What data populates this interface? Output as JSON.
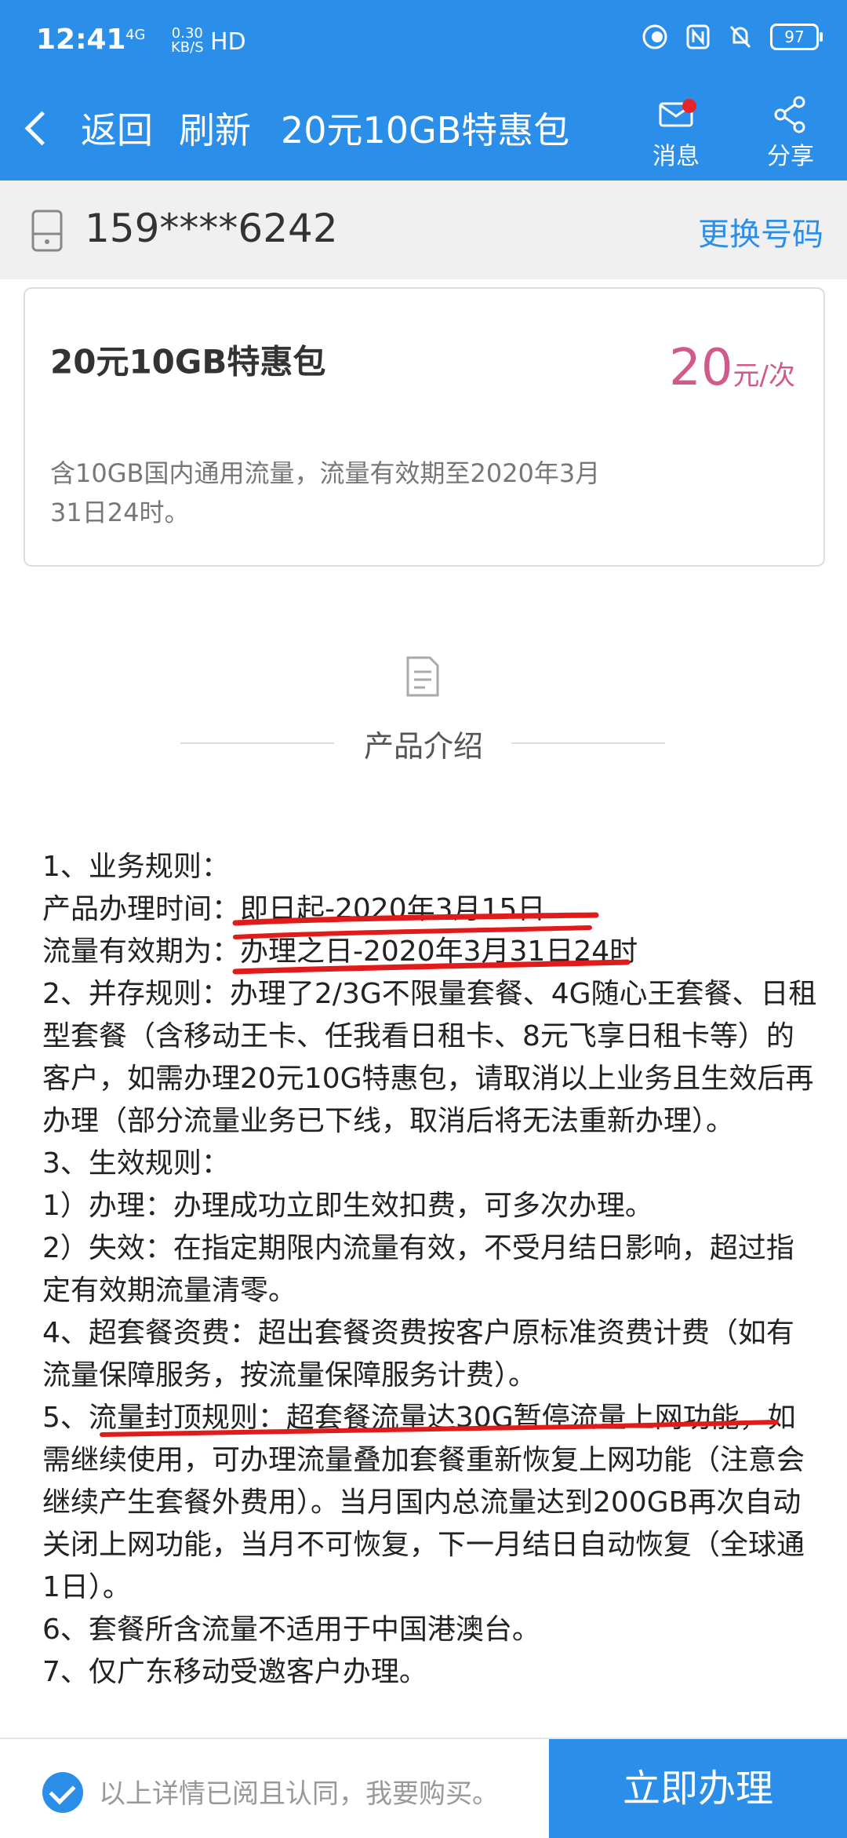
{
  "status_bar": {
    "time": "12:41",
    "network": "4G",
    "speed_value": "0.30",
    "speed_unit": "KB/S",
    "hd": "HD",
    "battery": "97"
  },
  "nav": {
    "back_label": "返回",
    "refresh_label": "刷新",
    "title": "20元10GB特惠包",
    "message_label": "消息",
    "share_label": "分享"
  },
  "phone": {
    "number": "159****6242",
    "change_label": "更换号码"
  },
  "product": {
    "name": "20元10GB特惠包",
    "price_value": "20",
    "price_unit": "元/次",
    "description": "含10GB国内通用流量，流量有效期至2020年3月31日24时。"
  },
  "intro": {
    "title": "产品介绍",
    "rules": [
      "1、业务规则：",
      "产品办理时间：即日起-2020年3月15日",
      "流量有效期为：办理之日-2020年3月31日24时",
      "2、并存规则：办理了2/3G不限量套餐、4G随心王套餐、日租型套餐（含移动王卡、任我看日租卡、8元飞享日租卡等）的客户，如需办理20元10G特惠包，请取消以上业务且生效后再办理（部分流量业务已下线，取消后将无法重新办理）。",
      "3、生效规则：",
      "1）办理：办理成功立即生效扣费，可多次办理。",
      "2）失效：在指定期限内流量有效，不受月结日影响，超过指定有效期流量清零。",
      "4、超套餐资费：超出套餐资费按客户原标准资费计费（如有流量保障服务，按流量保障服务计费）。",
      "5、流量封顶规则：超套餐流量达30G暂停流量上网功能，如需继续使用，可办理流量叠加套餐重新恢复上网功能（注意会继续产生套餐外费用）。当月国内总流量达到200GB再次自动关闭上网功能，当月不可恢复，下一月结日自动恢复（全球通1日）。",
      "6、套餐所含流量不适用于中国港澳台。",
      "7、仅广东移动受邀客户办理。"
    ]
  },
  "bottom": {
    "agree_text": "以上详情已阅且认同，我要购买。",
    "buy_label": "立即办理"
  },
  "colors": {
    "primary": "#2b8ee9",
    "price": "#d05a8a",
    "annotation": "#e01b1b"
  }
}
